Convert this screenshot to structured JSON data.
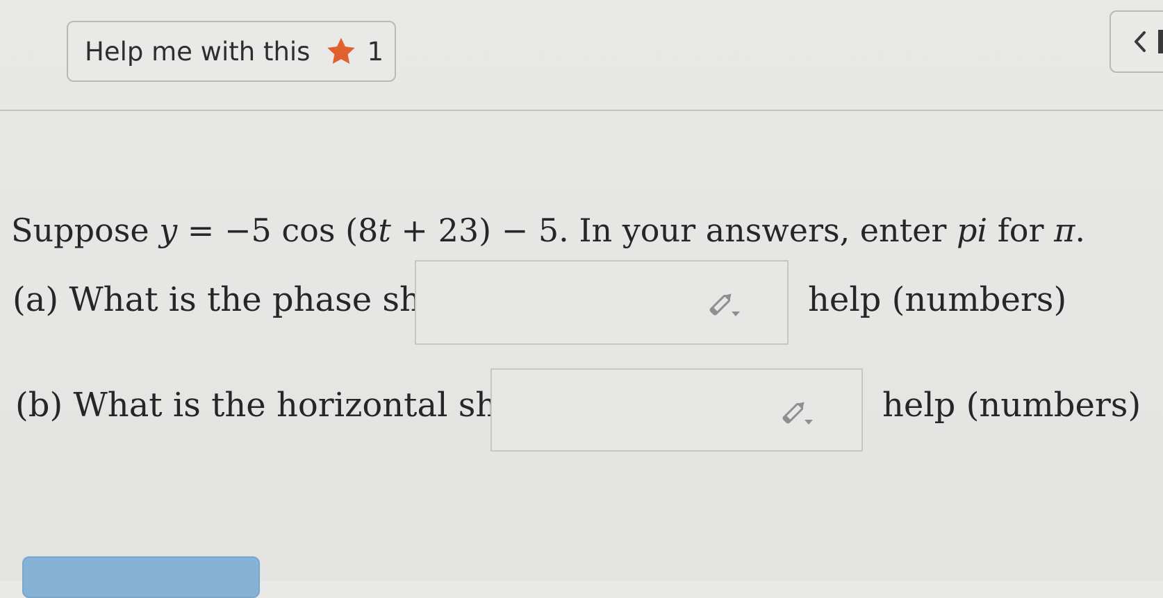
{
  "header": {
    "help_button_label": "Help me with this",
    "star_count": "1",
    "star_color": "#e0612e",
    "prev_icon": "chevron-left-icon"
  },
  "problem": {
    "statement": {
      "prefix": "Suppose ",
      "var_y": "y",
      "eq": " = −5 cos (8",
      "var_t": "t",
      "rest": " + 23) − 5. In your answers, enter ",
      "pi_word": "pi",
      "for": " for ",
      "pi_symbol": "π",
      "end": "."
    },
    "parts": [
      {
        "label": "(a) What is the phase shift?",
        "input_value": "",
        "edit_icon": "pencil-icon",
        "help_label": "help (numbers)"
      },
      {
        "label": "(b) What is the horizontal shift?",
        "input_value": "",
        "edit_icon": "pencil-icon",
        "help_label": "help (numbers)"
      }
    ]
  },
  "colors": {
    "background": "#e6e6e4",
    "submit_button": "#86b2d6"
  }
}
